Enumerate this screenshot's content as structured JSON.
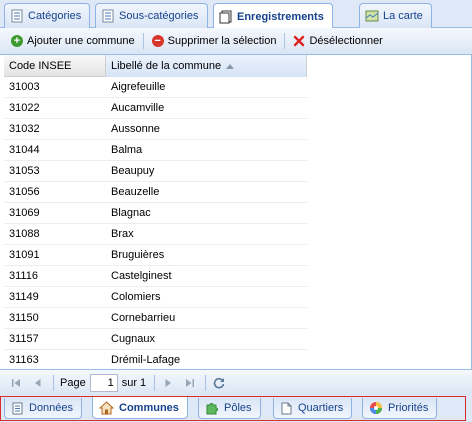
{
  "top_tabs": [
    {
      "label": "Catégories",
      "icon": "checklist-icon"
    },
    {
      "label": "Sous-catégories",
      "icon": "checklist-icon"
    },
    {
      "label": "Enregistrements",
      "icon": "records-icon",
      "active": true
    },
    {
      "label": "La carte",
      "icon": "map-icon"
    }
  ],
  "toolbar": {
    "add_label": "Ajouter une commune",
    "delete_label": "Supprimer la sélection",
    "deselect_label": "Désélectionner"
  },
  "grid": {
    "columns": [
      "Code INSEE",
      "Libellé de la commune"
    ],
    "sorted_column": "Libellé de la commune",
    "sort_direction": "asc",
    "rows": [
      {
        "code": "31003",
        "name": "Aigrefeuille"
      },
      {
        "code": "31022",
        "name": "Aucamville"
      },
      {
        "code": "31032",
        "name": "Aussonne"
      },
      {
        "code": "31044",
        "name": "Balma"
      },
      {
        "code": "31053",
        "name": "Beaupuy"
      },
      {
        "code": "31056",
        "name": "Beauzelle"
      },
      {
        "code": "31069",
        "name": "Blagnac"
      },
      {
        "code": "31088",
        "name": "Brax"
      },
      {
        "code": "31091",
        "name": "Bruguières"
      },
      {
        "code": "31116",
        "name": "Castelginest"
      },
      {
        "code": "31149",
        "name": "Colomiers"
      },
      {
        "code": "31150",
        "name": "Cornebarrieu"
      },
      {
        "code": "31157",
        "name": "Cugnaux"
      },
      {
        "code": "31163",
        "name": "Drémil-Lafage"
      }
    ]
  },
  "pager": {
    "page_label": "Page",
    "page_value": "1",
    "of_label": "sur 1"
  },
  "bottom_tabs": [
    {
      "label": "Données",
      "icon": "document-icon"
    },
    {
      "label": "Communes",
      "icon": "house-icon",
      "active": true
    },
    {
      "label": "Pôles",
      "icon": "puzzle-icon"
    },
    {
      "label": "Quartiers",
      "icon": "page-icon"
    },
    {
      "label": "Priorités",
      "icon": "color-wheel-icon"
    }
  ],
  "colors": {
    "header_blue": "#dfe8f6",
    "tab_text": "#15428b",
    "add_green": "#3c9a2e",
    "delete_red": "#d9362b",
    "highlight_frame": "#d92b2b"
  }
}
